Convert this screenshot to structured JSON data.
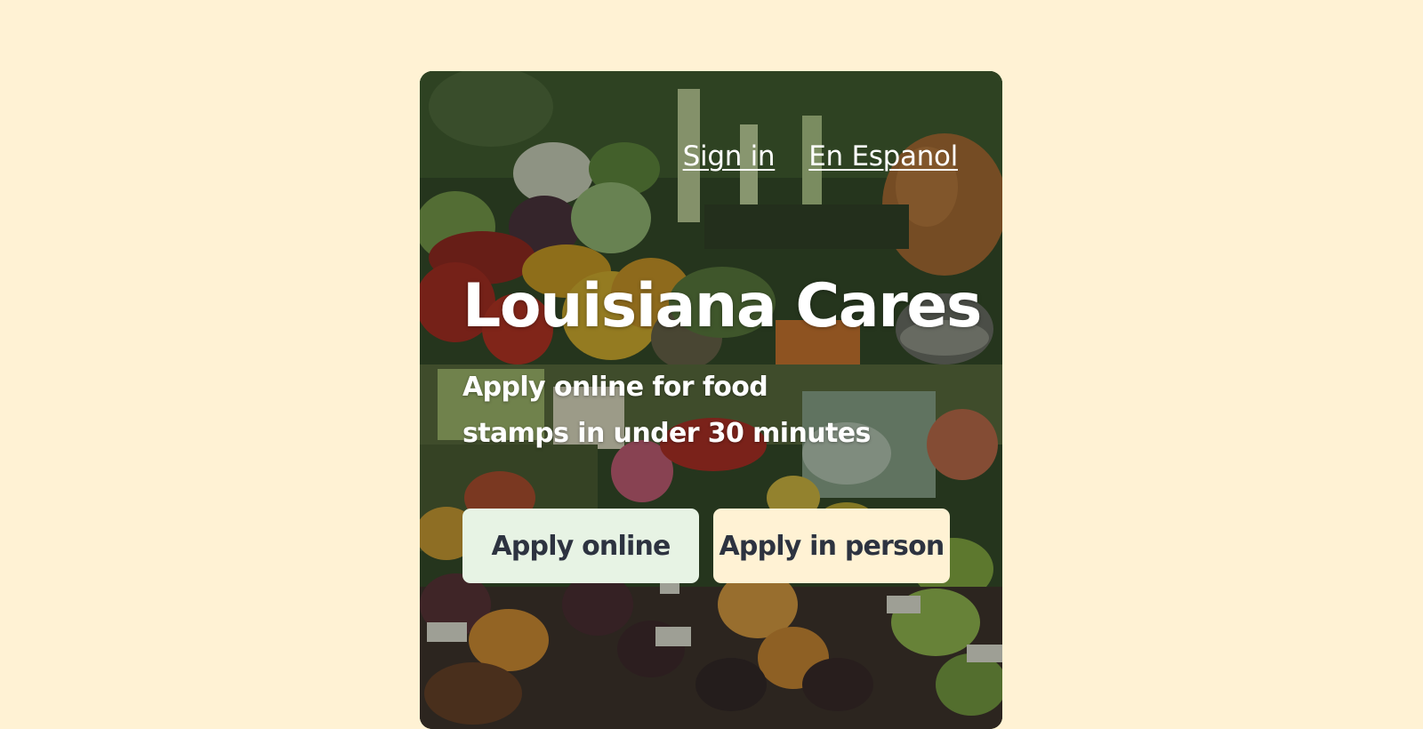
{
  "nav": {
    "sign_in": "Sign in",
    "spanish": "En Espanol"
  },
  "hero": {
    "title": "Louisiana Cares",
    "subtitle": "Apply online for food stamps in under 30 minutes",
    "background_image": "produce-market-photo"
  },
  "actions": {
    "apply_online": "Apply online",
    "apply_in_person": "Apply in person"
  },
  "colors": {
    "page_background": "#FFF2D4",
    "apply_online_bg": "#E7F3E4",
    "apply_in_person_bg": "#FFF2D4",
    "button_text": "#2d3340",
    "hero_text": "#ffffff"
  }
}
